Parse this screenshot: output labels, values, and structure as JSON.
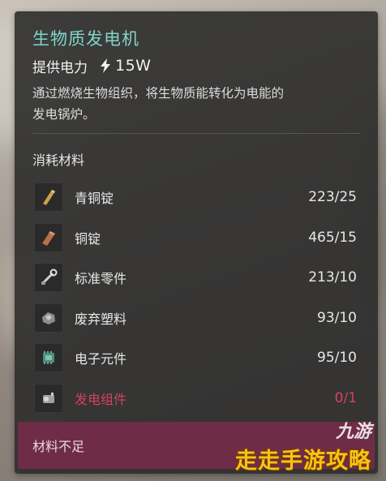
{
  "title": "生物质发电机",
  "power": {
    "label": "提供电力",
    "icon": "lightning-bolt-icon",
    "value": "15W"
  },
  "description_lines": [
    "通过燃烧生物组织，将生物质能转化为电能的",
    "发电锅炉。"
  ],
  "materials_section": {
    "title": "消耗材料",
    "items": [
      {
        "name": "青铜锭",
        "count": "223/25",
        "icon": "bronze-ingot-icon",
        "missing": false
      },
      {
        "name": "铜锭",
        "count": "465/15",
        "icon": "copper-ingot-icon",
        "missing": false
      },
      {
        "name": "标准零件",
        "count": "213/10",
        "icon": "standard-parts-icon",
        "missing": false
      },
      {
        "name": "废弃塑料",
        "count": "93/10",
        "icon": "scrap-plastic-icon",
        "missing": false
      },
      {
        "name": "电子元件",
        "count": "95/10",
        "icon": "electronic-component-icon",
        "missing": false
      },
      {
        "name": "发电组件",
        "count": "0/1",
        "icon": "generator-component-icon",
        "missing": true
      }
    ]
  },
  "status": {
    "text": "材料不足"
  },
  "watermark": {
    "top": "九游",
    "main": "走走手游攻略"
  },
  "colors": {
    "title": "#7fd6c8",
    "missing": "#d4415f",
    "status_bg": "#6e2c46",
    "panel_bg": "#2c2c2c"
  }
}
